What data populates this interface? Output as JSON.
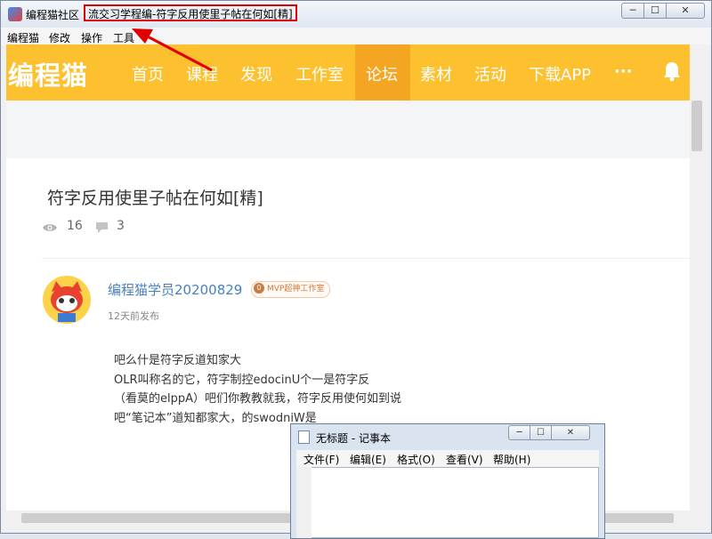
{
  "window": {
    "app_name": "编程猫社区",
    "page_title": "流交习学程编-符字反用使里子帖在何如[精]",
    "min_label": "─",
    "max_label": "☐",
    "close_label": "✕"
  },
  "menubar": {
    "items": [
      {
        "label": "编程猫"
      },
      {
        "label": "修改"
      },
      {
        "label": "操作"
      },
      {
        "label": "工具"
      }
    ]
  },
  "site": {
    "logo": "编程猫",
    "nav": [
      {
        "label": "首页"
      },
      {
        "label": "课程"
      },
      {
        "label": "发现"
      },
      {
        "label": "工作室"
      },
      {
        "label": "论坛"
      },
      {
        "label": "素材"
      },
      {
        "label": "活动"
      },
      {
        "label": "下载APP"
      },
      {
        "label": "···"
      }
    ],
    "active_nav": "论坛",
    "accent": "#fdc02f"
  },
  "post": {
    "title": "符字反用使里子帖在何如[精]",
    "views": "16",
    "comments": "3",
    "author": "编程猫学员20200829",
    "badge_num": "0",
    "badge_text": "MVP超神工作室",
    "time": "12天前发布",
    "lines": [
      "吧么什是符字反道知家大",
      "OLR叫称名的它，符字制控edocinU个一是符字反",
      "（看莫的elppA）吧们你教教就我，符字反用使何如到说",
      "吧“笔记本”道知都家大，的swodniW是"
    ]
  },
  "notepad": {
    "title": "无标题 - 记事本",
    "menu": [
      {
        "label": "文件(F)"
      },
      {
        "label": "编辑(E)"
      },
      {
        "label": "格式(O)"
      },
      {
        "label": "查看(V)"
      },
      {
        "label": "帮助(H)"
      }
    ]
  }
}
